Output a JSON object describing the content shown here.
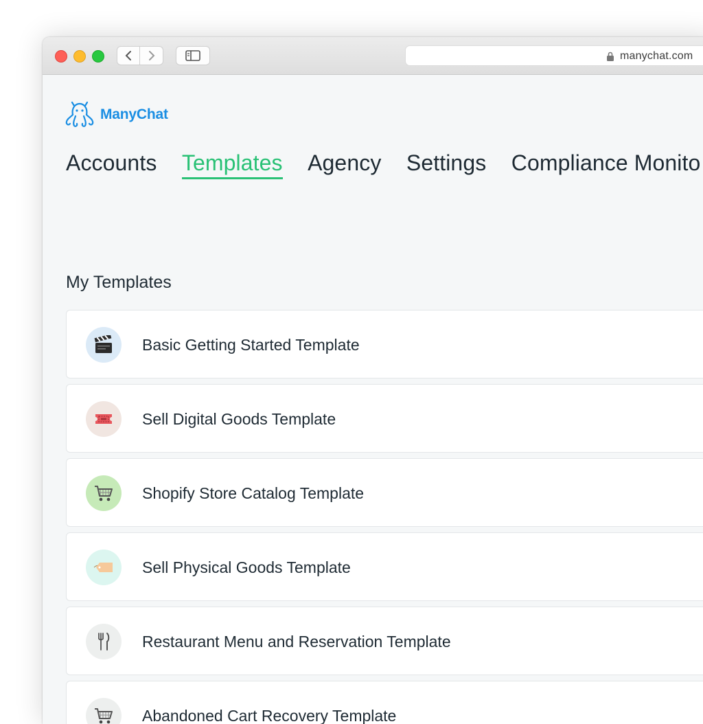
{
  "browser": {
    "url": "manychat.com"
  },
  "brand": {
    "name": "ManyChat",
    "color": "#1a8ee3"
  },
  "nav": {
    "accent": "#29c175",
    "tabs": [
      {
        "label": "Accounts",
        "active": false
      },
      {
        "label": "Templates",
        "active": true
      },
      {
        "label": "Agency",
        "active": false
      },
      {
        "label": "Settings",
        "active": false
      },
      {
        "label": "Compliance Monito",
        "active": false
      }
    ]
  },
  "section": {
    "title": "My Templates"
  },
  "templates": [
    {
      "title": "Basic Getting Started Template",
      "icon": "clapperboard-icon",
      "bg": "#dbeaf7"
    },
    {
      "title": "Sell Digital Goods Template",
      "icon": "ticket-icon",
      "bg": "#f1e6e1"
    },
    {
      "title": "Shopify Store Catalog Template",
      "icon": "shopping-cart-icon",
      "bg": "#c6eab8"
    },
    {
      "title": "Sell Physical Goods Template",
      "icon": "price-tag-icon",
      "bg": "#dcf6f0"
    },
    {
      "title": "Restaurant Menu and Reservation Template",
      "icon": "fork-knife-icon",
      "bg": "#edefee"
    },
    {
      "title": "Abandoned Cart Recovery Template",
      "icon": "shopping-cart-icon",
      "bg": "#edefee"
    }
  ]
}
